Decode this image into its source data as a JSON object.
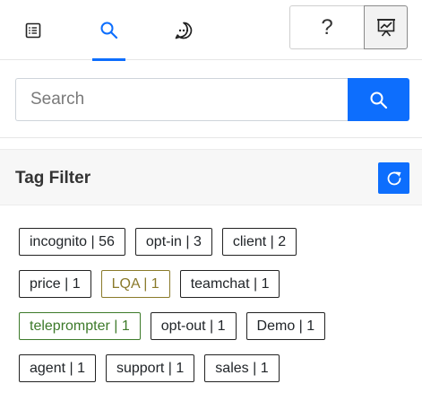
{
  "toolbar": {
    "tabs": [
      {
        "name": "notes",
        "icon": "list-icon",
        "active": false
      },
      {
        "name": "search",
        "icon": "search-icon",
        "active": true
      },
      {
        "name": "chat",
        "icon": "chat-bubble-icon",
        "active": false
      }
    ],
    "help_label": "?",
    "present_icon": "presentation-icon"
  },
  "search": {
    "placeholder": "Search",
    "value": "",
    "button_icon": "search-icon"
  },
  "tag_filter": {
    "title": "Tag Filter",
    "refresh_icon": "refresh-icon",
    "rows": [
      [
        {
          "label": "incognito | 56",
          "style": "default"
        },
        {
          "label": "opt-in | 3",
          "style": "default"
        },
        {
          "label": "client | 2",
          "style": "default"
        }
      ],
      [
        {
          "label": "price | 1",
          "style": "default"
        },
        {
          "label": "LQA | 1",
          "style": "olive"
        },
        {
          "label": "teamchat | 1",
          "style": "default"
        }
      ],
      [
        {
          "label": "teleprompter | 1",
          "style": "green"
        },
        {
          "label": "opt-out | 1",
          "style": "default"
        },
        {
          "label": "Demo | 1",
          "style": "default"
        }
      ],
      [
        {
          "label": "agent | 1",
          "style": "default"
        },
        {
          "label": "support | 1",
          "style": "default"
        },
        {
          "label": "sales | 1",
          "style": "default"
        }
      ]
    ]
  },
  "colors": {
    "accent": "#0d6efd",
    "olive_tag": "#8a7a2a",
    "green_tag": "#3d7a2a"
  }
}
